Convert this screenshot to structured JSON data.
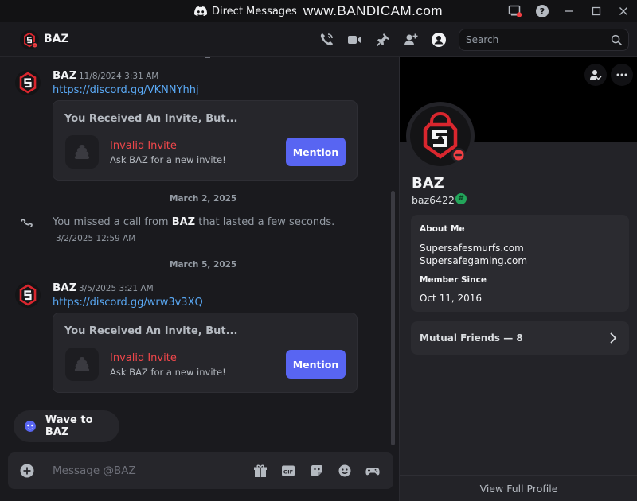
{
  "titlebar": {
    "title": "Direct Messages",
    "watermark": "www.BANDICAM.com"
  },
  "header": {
    "name": "BAZ",
    "search_placeholder": "Search"
  },
  "messages": [
    {
      "author": "BAZ",
      "timestamp": "11/8/2024 3:31 AM",
      "link": "https://discord.gg/VKNNYhhj",
      "invite": {
        "title": "You Received An Invite, But...",
        "label": "Invalid Invite",
        "sub": "Ask BAZ for a new invite!",
        "button": "Mention"
      }
    },
    {
      "author": "BAZ",
      "timestamp": "3/5/2025 3:21 AM",
      "link": "https://discord.gg/wrw3v3XQ",
      "invite": {
        "title": "You Received An Invite, But...",
        "label": "Invalid Invite",
        "sub": "Ask BAZ for a new invite!",
        "button": "Mention"
      }
    }
  ],
  "dividers": [
    "March 2, 2025",
    "March 5, 2025"
  ],
  "call": {
    "prefix": "You missed a call from ",
    "name": "BAZ",
    "suffix": " that lasted a few seconds.",
    "time": "3/2/2025 12:59 AM"
  },
  "wave": {
    "label": "Wave to BAZ"
  },
  "composer": {
    "placeholder": "Message @BAZ"
  },
  "profile": {
    "name": "BAZ",
    "username": "baz6422",
    "about_heading": "About Me",
    "about_lines": [
      "Supersafesmurfs.com",
      "Supersafegaming.com"
    ],
    "member_heading": "Member Since",
    "member_since": "Oct 11, 2016",
    "mutual_friends": "Mutual Friends — 8",
    "view_full": "View Full Profile"
  },
  "colors": {
    "accent": "#5865f2",
    "invalid": "#f0474b",
    "link": "#5aa9f5",
    "dnd": "#f23f43",
    "brand_red": "#d9262e"
  }
}
